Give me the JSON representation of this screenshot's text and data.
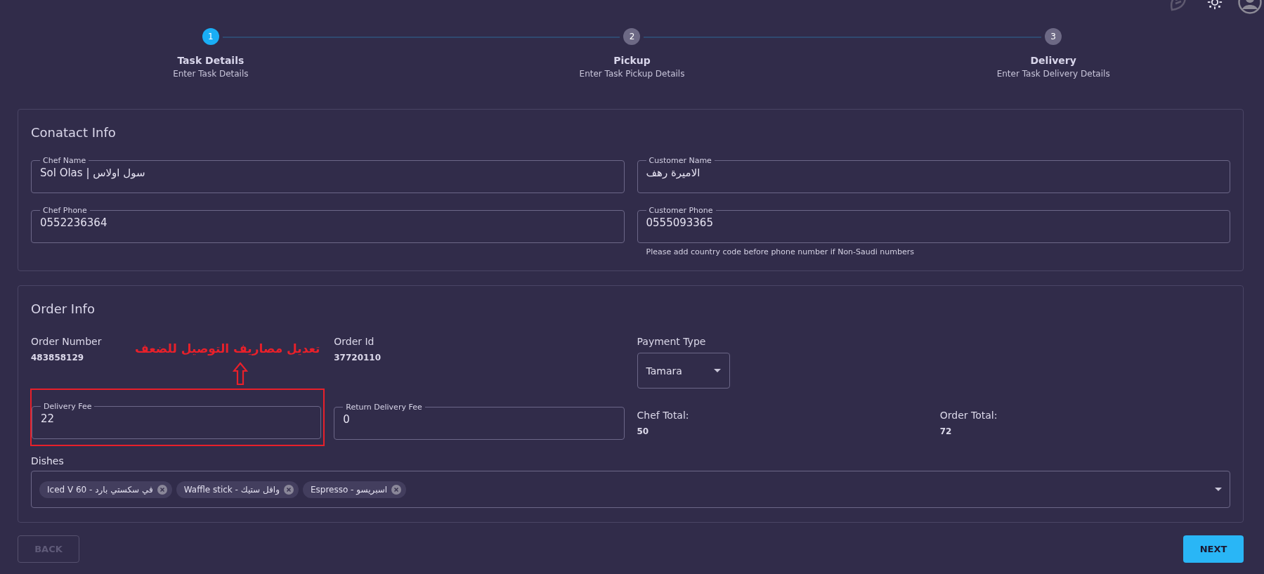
{
  "stepper": {
    "steps": [
      {
        "number": "1",
        "title": "Task Details",
        "subtitle": "Enter Task Details",
        "selected": true
      },
      {
        "number": "2",
        "title": "Pickup",
        "subtitle": "Enter Task Pickup Details",
        "selected": false
      },
      {
        "number": "3",
        "title": "Delivery",
        "subtitle": "Enter Task Delivery Details",
        "selected": false
      }
    ]
  },
  "contact_info": {
    "title": "Conatact Info",
    "fields": [
      {
        "label": "Chef Name",
        "value": "Sol Olas | سول اولاس"
      },
      {
        "label": "Customer Name",
        "value": "الاميرة رهف"
      },
      {
        "label": "Chef Phone",
        "value": "0552236364"
      },
      {
        "label": "Customer Phone",
        "value": "0555093365"
      }
    ],
    "helper_text": "Please add country code before phone number if Non-Saudi numbers"
  },
  "order_info": {
    "title": "Order Info",
    "order_number": {
      "label": "Order Number",
      "value": "483858129"
    },
    "order_id": {
      "label": "Order Id",
      "value": "37720110"
    },
    "payment_type": {
      "label": "Payment Type",
      "value": "Tamara"
    },
    "delivery_fee": {
      "label": "Delivery Fee",
      "value": "22"
    },
    "return_delivery_fee": {
      "label": "Return Delivery Fee",
      "value": "0"
    },
    "chef_total": {
      "label": "Chef Total:",
      "value": "50"
    },
    "order_total": {
      "label": "Order Total:",
      "value": "72"
    },
    "dishes": {
      "label": "Dishes",
      "chips": [
        "Iced V 60 - في سكستي بارد",
        "Waffle stick - وافل ستيك",
        "Espresso - اسبريسو"
      ]
    }
  },
  "annotation": {
    "text": "تعديل مصاريف التوصيل للضعف"
  },
  "buttons": {
    "back": {
      "label": "BACK",
      "disabled": true
    },
    "next": {
      "label": "NEXT",
      "disabled": false
    }
  }
}
